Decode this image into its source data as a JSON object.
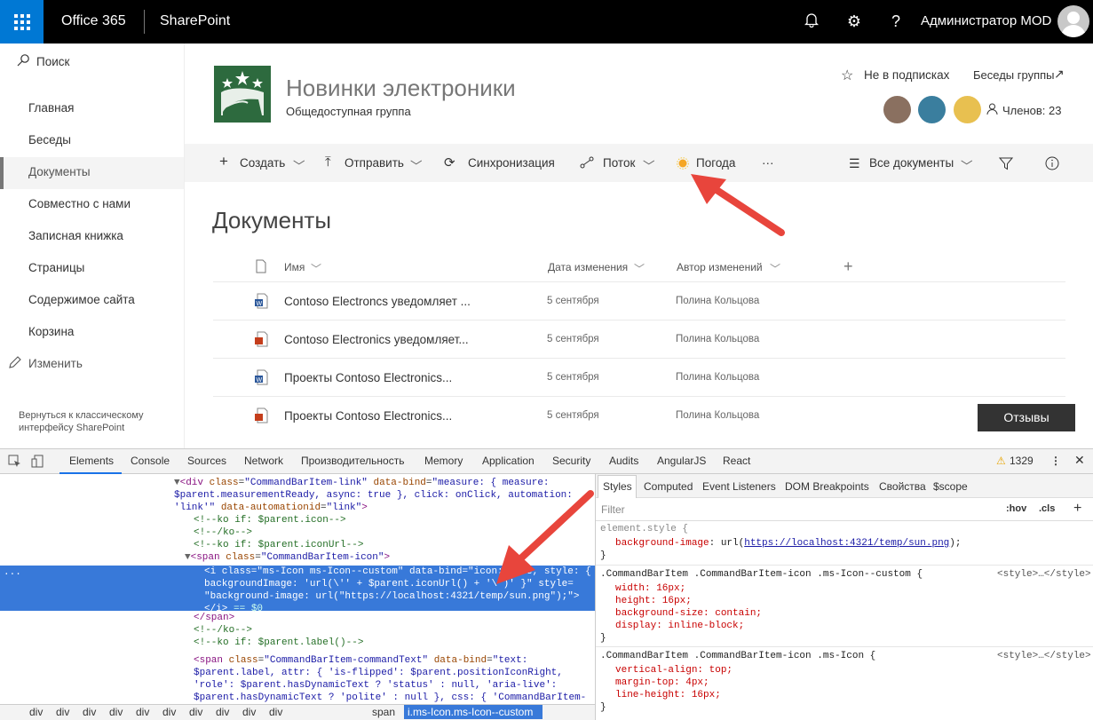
{
  "topbar": {
    "brand": "Office 365",
    "app": "SharePoint",
    "user": "Администратор MOD",
    "icons": [
      "bell-icon",
      "gear-icon",
      "help-icon"
    ]
  },
  "nav": {
    "search": "Поиск",
    "items": [
      "Главная",
      "Беседы",
      "Документы",
      "Совместно с нами",
      "Записная книжка",
      "Страницы",
      "Содержимое сайта",
      "Корзина"
    ],
    "edit": "Изменить",
    "selected": "Документы",
    "classic": "Вернуться к классическому интерфейсу SharePoint"
  },
  "site": {
    "title": "Новинки электроники",
    "subtitle": "Общедоступная группа",
    "follow": "Не в подписках",
    "conversations": "Беседы группы",
    "members": "Членов: 23"
  },
  "cmdbar": {
    "new": "Создать",
    "upload": "Отправить",
    "sync": "Синхронизация",
    "flow": "Поток",
    "weather": "Погода",
    "more": "···",
    "view": "Все документы"
  },
  "library": {
    "title": "Документы",
    "columns": {
      "name": "Имя",
      "modified": "Дата изменения",
      "author": "Автор изменений"
    },
    "rows": [
      {
        "name": "Contoso Electroncs уведомляет ...",
        "date": "5 сентября",
        "author": "Полина Кольцова",
        "type": "word"
      },
      {
        "name": "Contoso Electronics уведомляет...",
        "date": "5 сентября",
        "author": "Полина Кольцова",
        "type": "ppt"
      },
      {
        "name": "Проекты Contoso Electronics...",
        "date": "5 сентября",
        "author": "Полина Кольцова",
        "type": "word"
      },
      {
        "name": "Проекты Contoso Electronics...",
        "date": "5 сентября",
        "author": "Полина Кольцова",
        "type": "ppt"
      }
    ],
    "feedback": "Отзывы"
  },
  "devtools": {
    "tabs": [
      "Elements",
      "Console",
      "Sources",
      "Network",
      "Производительность",
      "Memory",
      "Application",
      "Security",
      "Audits",
      "AngularJS",
      "React"
    ],
    "warnings": "1329",
    "styles_tabs": [
      "Styles",
      "Computed",
      "Event Listeners",
      "DOM Breakpoints",
      "Свойства",
      "$scope"
    ],
    "filter": "Filter",
    "hov": ":hov",
    "cls": ".cls",
    "crumbs": [
      "div",
      "div",
      "div",
      "div",
      "div",
      "div",
      "div",
      "div",
      "div",
      "div",
      "span"
    ],
    "crumb_selected": "i.ms-Icon.ms-Icon--custom",
    "rule1": {
      "selector": "element.style {",
      "prop": "background-image",
      "val": "url(",
      "url": "https://localhost:4321/temp/sun.png",
      "end": ");"
    },
    "rule2": {
      "selector": ".CommandBarItem .CommandBarItem-icon .ms-Icon--custom {",
      "src": "<style>…</style>",
      "decls": [
        "width: 16px;",
        "height: 16px;",
        "background-size: contain;",
        "display: inline-block;"
      ]
    },
    "rule3": {
      "selector": ".CommandBarItem .CommandBarItem-icon .ms-Icon {",
      "src": "<style>…</style>",
      "decls": [
        "vertical-align: top;",
        "margin-top: 4px;",
        "line-height: 16px;"
      ]
    },
    "close": "}"
  }
}
